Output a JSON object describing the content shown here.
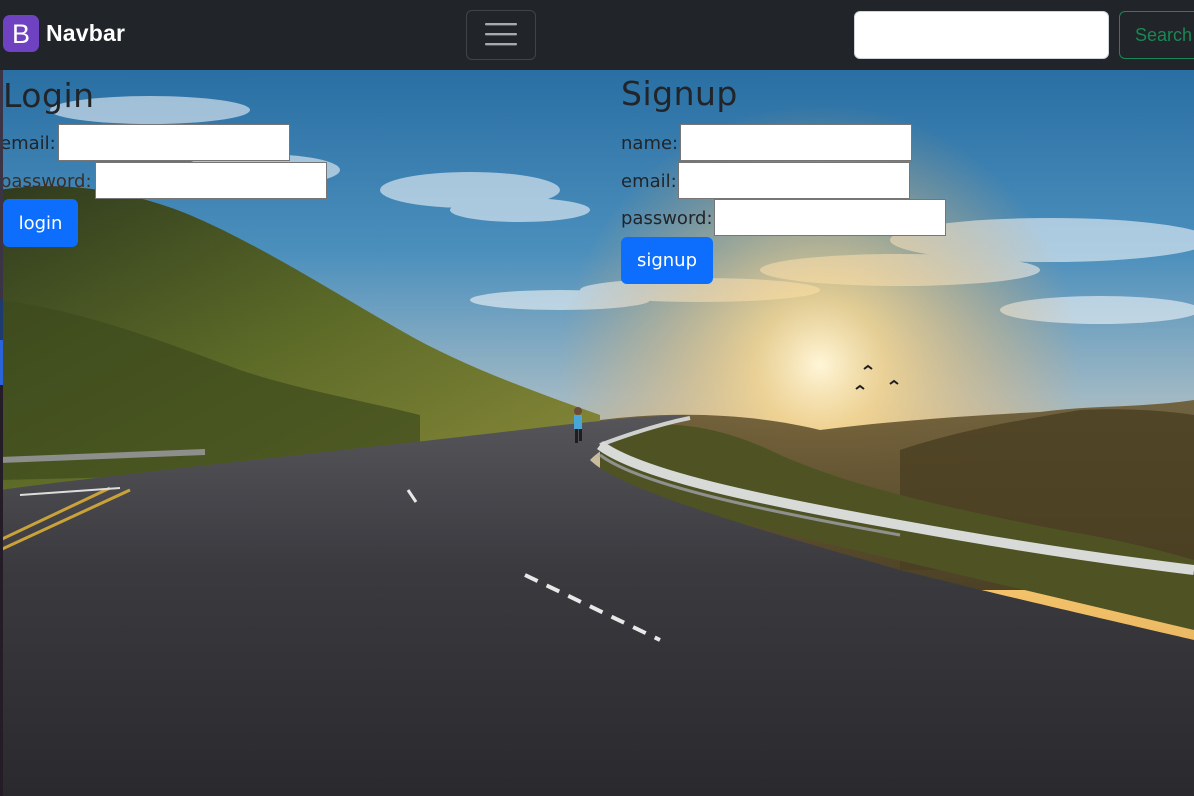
{
  "navbar": {
    "brand_letter": "B",
    "brand_name": "Navbar",
    "search_placeholder": "",
    "search_button": "Search"
  },
  "login": {
    "title": "Login",
    "email_label": "email:",
    "password_label": "password:",
    "button": "login"
  },
  "signup": {
    "title": "Signup",
    "name_label": "name:",
    "email_label": "email:",
    "password_label": "password:",
    "button": "signup"
  },
  "colors": {
    "navbar_bg": "#212529",
    "brand_purple": "#6f42c1",
    "primary": "#0d6efd",
    "success": "#198754"
  }
}
